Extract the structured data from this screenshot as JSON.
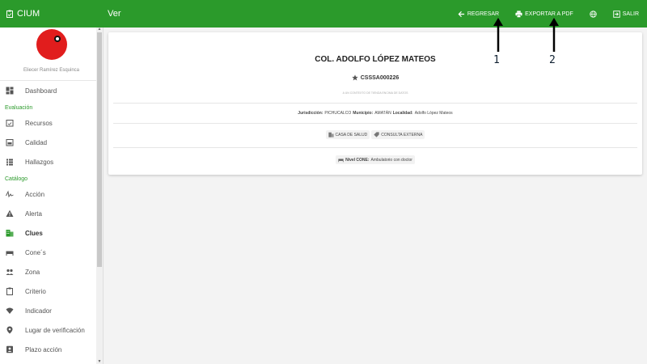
{
  "app": {
    "name": "CIUM",
    "page": "Ver"
  },
  "actions": {
    "back": "REGRESAR",
    "export": "EXPORTAR A PDF",
    "logout": "SALIR"
  },
  "profile": {
    "name": "Eliecer Ramírez Esquinca"
  },
  "sidebar": {
    "dashboard": "Dashboard",
    "section_eval": "Evaluación",
    "eval_items": [
      "Recursos",
      "Calidad",
      "Hallazgos"
    ],
    "section_cat": "Catálogo",
    "cat_items": [
      "Acción",
      "Alerta",
      "Clues",
      "Cone´s",
      "Zona",
      "Criterio",
      "Indicador",
      "Lugar de verificación",
      "Plazo acción"
    ]
  },
  "card": {
    "title": "COL. ADOLFO LÓPEZ MATEOS",
    "code": "CSSSA000226",
    "tiny": "A UN CONTEXTO DE TIENDA ENCIMA DE DATOS",
    "jurisdiccion_label": "Jurisdicción:",
    "jurisdiccion": "PICHUCALCO",
    "municipio_label": "Municipio:",
    "municipio": "AMATÁN",
    "localidad_label": "Localidad:",
    "localidad": "Adolfo López Mateos",
    "tipo": "CASA DE SALUD",
    "consulta": "CONSULTA EXTERNA",
    "nivel_label": "Nivel CONE:",
    "nivel": "Ambulatorio con doctor"
  },
  "annotations": [
    "1",
    "2"
  ]
}
